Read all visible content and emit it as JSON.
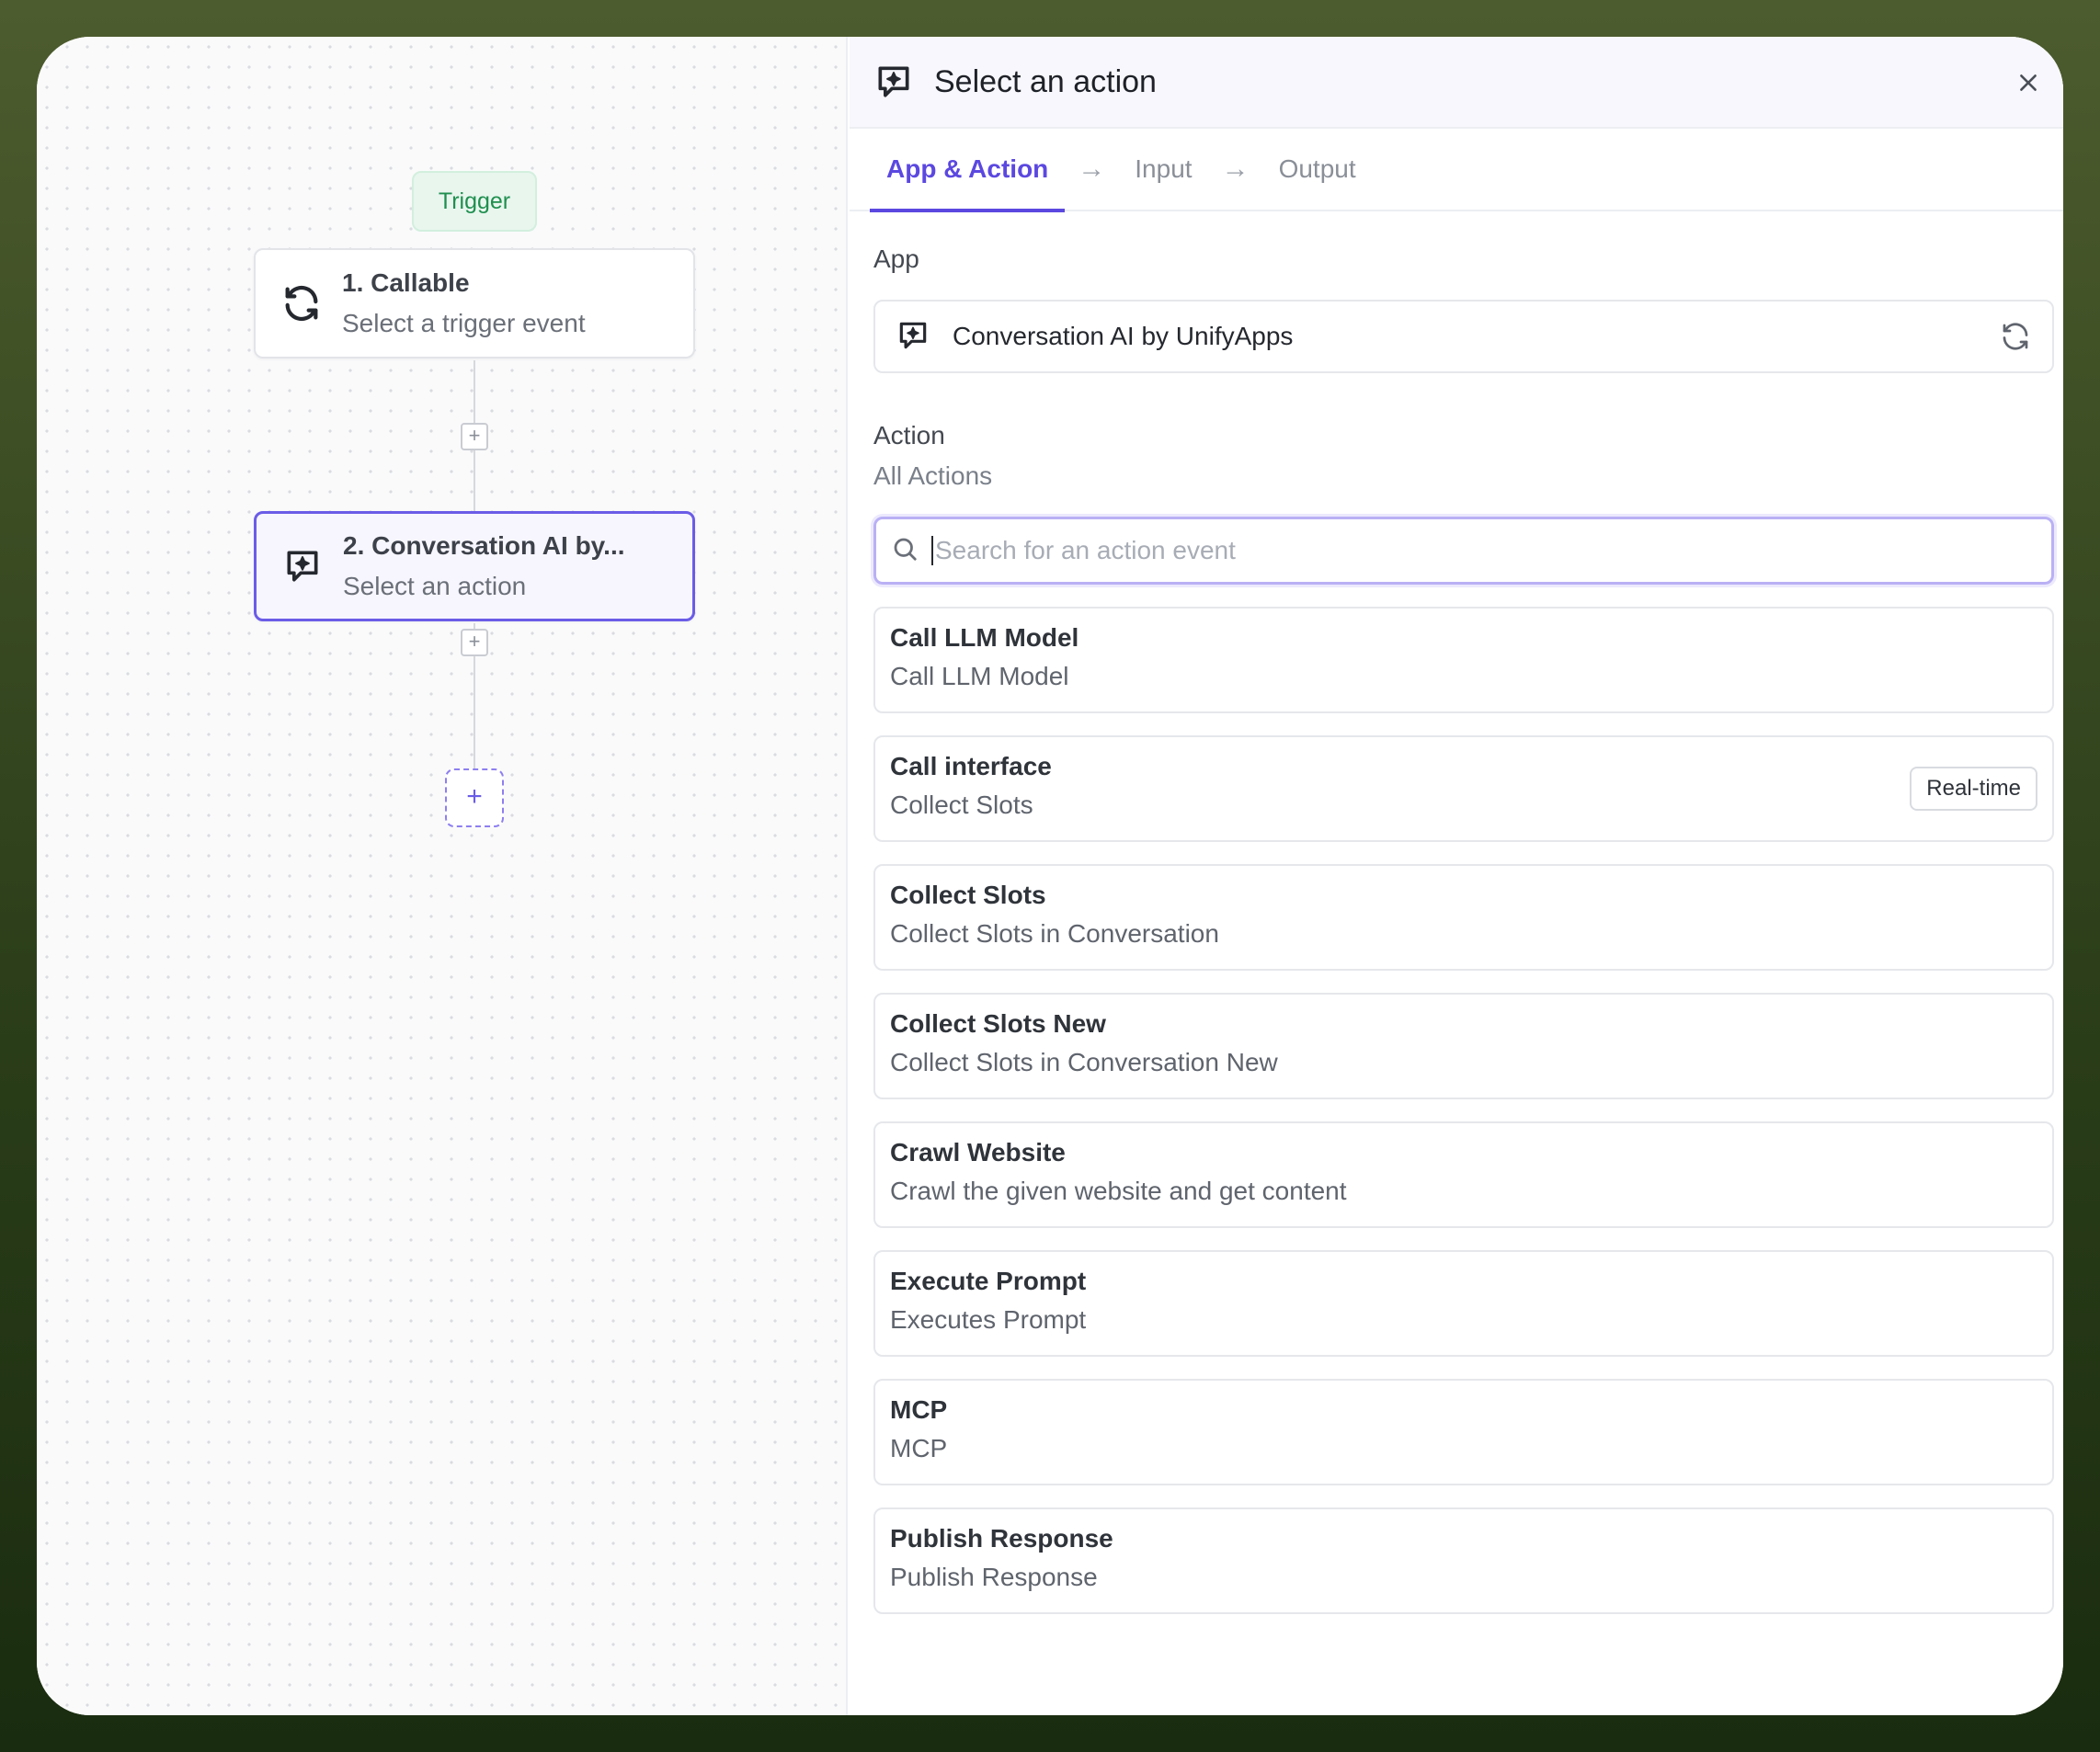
{
  "canvas": {
    "trigger_label": "Trigger",
    "nodes": [
      {
        "title": "1. Callable",
        "subtitle": "Select a trigger event",
        "icon": "refresh-cycle-icon"
      },
      {
        "title": "2. Conversation AI by...",
        "subtitle": "Select an action",
        "icon": "ai-chat-sparkle-icon"
      }
    ],
    "plus_symbol": "+"
  },
  "panel": {
    "title": "Select an action",
    "tabs": [
      {
        "label": "App & Action",
        "active": true
      },
      {
        "label": "Input",
        "active": false
      },
      {
        "label": "Output",
        "active": false
      }
    ],
    "app_section_label": "App",
    "app_name": "Conversation AI by UnifyApps",
    "action_section_label": "Action",
    "action_filter": "All Actions",
    "search_placeholder": "Search for an action event",
    "actions": [
      {
        "title": "Call LLM Model",
        "desc": "Call LLM Model",
        "badge": ""
      },
      {
        "title": "Call interface",
        "desc": "Collect Slots",
        "badge": "Real-time"
      },
      {
        "title": "Collect Slots",
        "desc": "Collect Slots in Conversation",
        "badge": ""
      },
      {
        "title": "Collect Slots New",
        "desc": "Collect Slots in Conversation New",
        "badge": ""
      },
      {
        "title": "Crawl Website",
        "desc": "Crawl the given website and get content",
        "badge": ""
      },
      {
        "title": "Execute Prompt",
        "desc": "Executes Prompt",
        "badge": ""
      },
      {
        "title": "MCP",
        "desc": "MCP",
        "badge": ""
      },
      {
        "title": "Publish Response",
        "desc": "Publish Response",
        "badge": ""
      }
    ]
  },
  "colors": {
    "accent": "#5b48e0",
    "trigger_green": "#1f8f4e",
    "outer_background": "#3e4e24"
  }
}
